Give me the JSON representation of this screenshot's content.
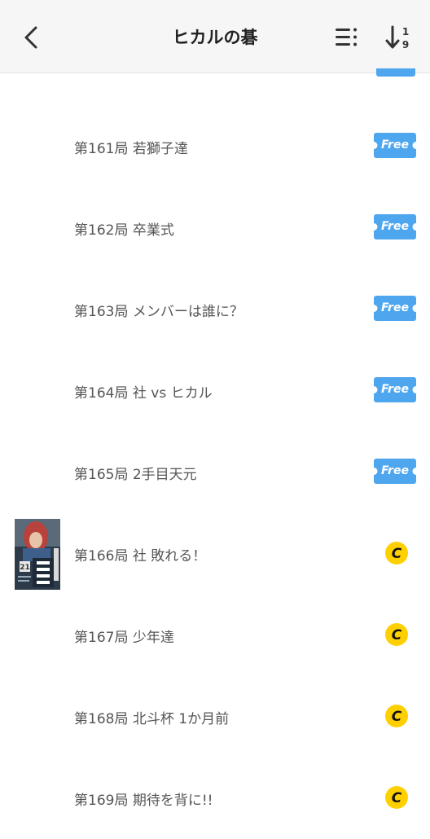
{
  "header": {
    "title": "ヒカルの碁",
    "back_icon": "chevron-left-icon",
    "list_icon": "list-menu-icon",
    "sort_icon": "sort-ascending-icon"
  },
  "colors": {
    "free_badge": "#4ea6ee",
    "coin": "#ffd000",
    "text": "#555555"
  },
  "chapters": [
    {
      "label": "第161局 若獅子達",
      "badge": "Free"
    },
    {
      "label": "第162局 卒業式",
      "badge": "Free"
    },
    {
      "label": "第163局 メンバーは誰に？",
      "badge": "Free"
    },
    {
      "label": "第164局 社 vs ヒカル",
      "badge": "Free"
    },
    {
      "label": "第165局 2手目天元",
      "badge": "Free"
    },
    {
      "label": "第166局 社 敗れる！",
      "badge": "coin"
    },
    {
      "label": "第167局 少年達",
      "badge": "coin"
    },
    {
      "label": "第168局 北斗杯 1か月前",
      "badge": "coin"
    },
    {
      "label": "第169局 期待を背に!!",
      "badge": "coin"
    }
  ],
  "cover": {
    "icon": "volume-cover-image",
    "volume": "21"
  }
}
